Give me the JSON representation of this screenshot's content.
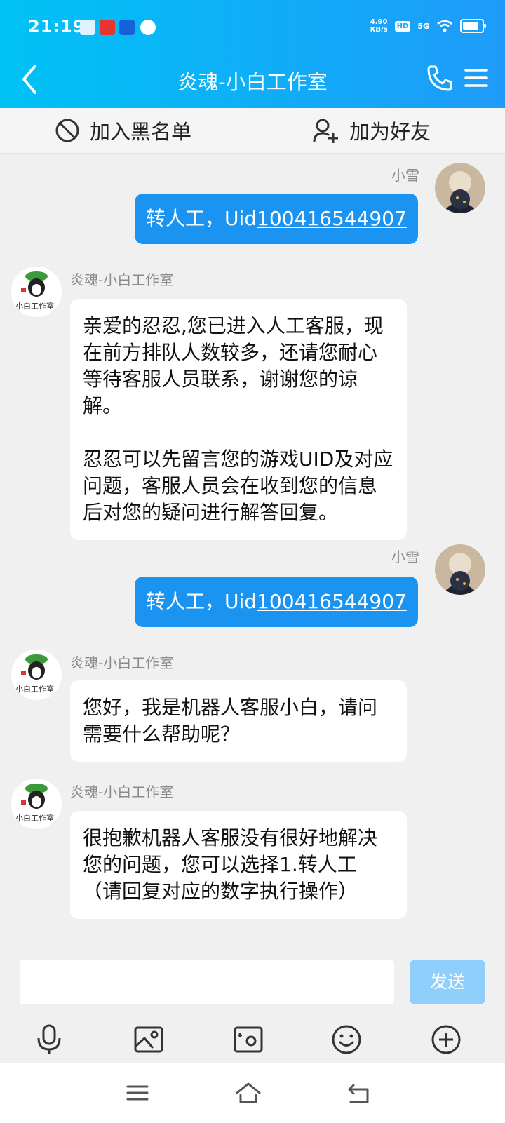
{
  "status_bar": {
    "time": "21:19",
    "speed_value": "4.90",
    "speed_unit": "KB/s",
    "hd": "HD",
    "network": "5G"
  },
  "header": {
    "title": "炎魂-小白工作室"
  },
  "actions": {
    "blacklist_label": "加入黑名单",
    "add_friend_label": "加为好友"
  },
  "messages": [
    {
      "sender": "小雪",
      "text_prefix": "转人工，Uid",
      "uid": "100416544907"
    },
    {
      "sender": "炎魂-小白工作室",
      "paragraphs": [
        "亲爱的忍忍,您已进入人工客服，现在前方排队人数较多，还请您耐心等待客服人员联系，谢谢您的谅解。",
        "忍忍可以先留言您的游戏UID及对应问题，客服人员会在收到您的信息后对您的疑问进行解答回复。"
      ]
    },
    {
      "sender": "小雪",
      "text_prefix": "转人工，Uid",
      "uid": "100416544907"
    },
    {
      "sender": "炎魂-小白工作室",
      "paragraphs": [
        "您好，我是机器人客服小白，请问需要什么帮助呢？"
      ]
    },
    {
      "sender": "炎魂-小白工作室",
      "paragraphs": [
        "很抱歉机器人客服没有很好地解决您的问题，您可以选择1.转人工（请回复对应的数字执行操作）"
      ]
    }
  ],
  "avatar_label": "小白工作室",
  "input": {
    "placeholder": "",
    "send_label": "发送"
  },
  "colors": {
    "header_start": "#00c2f5",
    "header_end": "#1e9bf9",
    "bubble_self": "#1a94f0",
    "send_disabled": "#8ecffb"
  }
}
